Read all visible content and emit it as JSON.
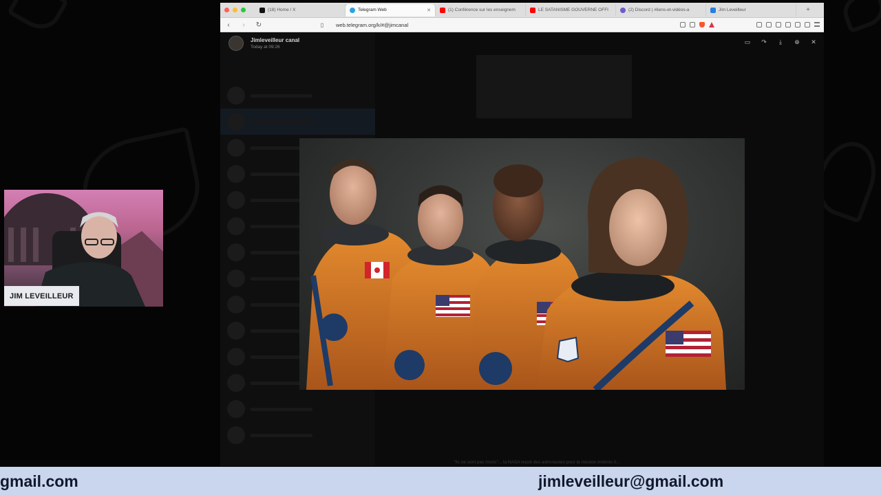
{
  "browser": {
    "tabs": [
      {
        "label": "(18) Home / X",
        "favicon_color": "#111111",
        "active": false
      },
      {
        "label": "Telegram Web",
        "favicon_color": "#2aa3e0",
        "active": true
      },
      {
        "label": "(1) Conférence sur les enseignem",
        "favicon_color": "#ff0000",
        "active": false
      },
      {
        "label": "LE SATANISME GOUVERNE OFFI",
        "favicon_color": "#ff0000",
        "active": false
      },
      {
        "label": "(2) Discord | #liens-et-vidéos-a",
        "favicon_color": "#6d5bd0",
        "active": false
      },
      {
        "label": "Jim Leveilleur",
        "favicon_color": "#2a7de1",
        "active": false
      }
    ],
    "url": "web.telegram.org/k/#@jimcanal"
  },
  "telegram": {
    "channel_name": "Jimleveilleur canal",
    "message_time": "Today at 09:26",
    "caption": "\"Ils ne sont pas morts\"... la NASA reçoit des astronautes pour la mission Artémis II..."
  },
  "webcam": {
    "name_label": "JIM LEVEILLEUR"
  },
  "banner": {
    "left_text": "gmail.com",
    "right_text": "jimleveilleur@gmail.com"
  }
}
